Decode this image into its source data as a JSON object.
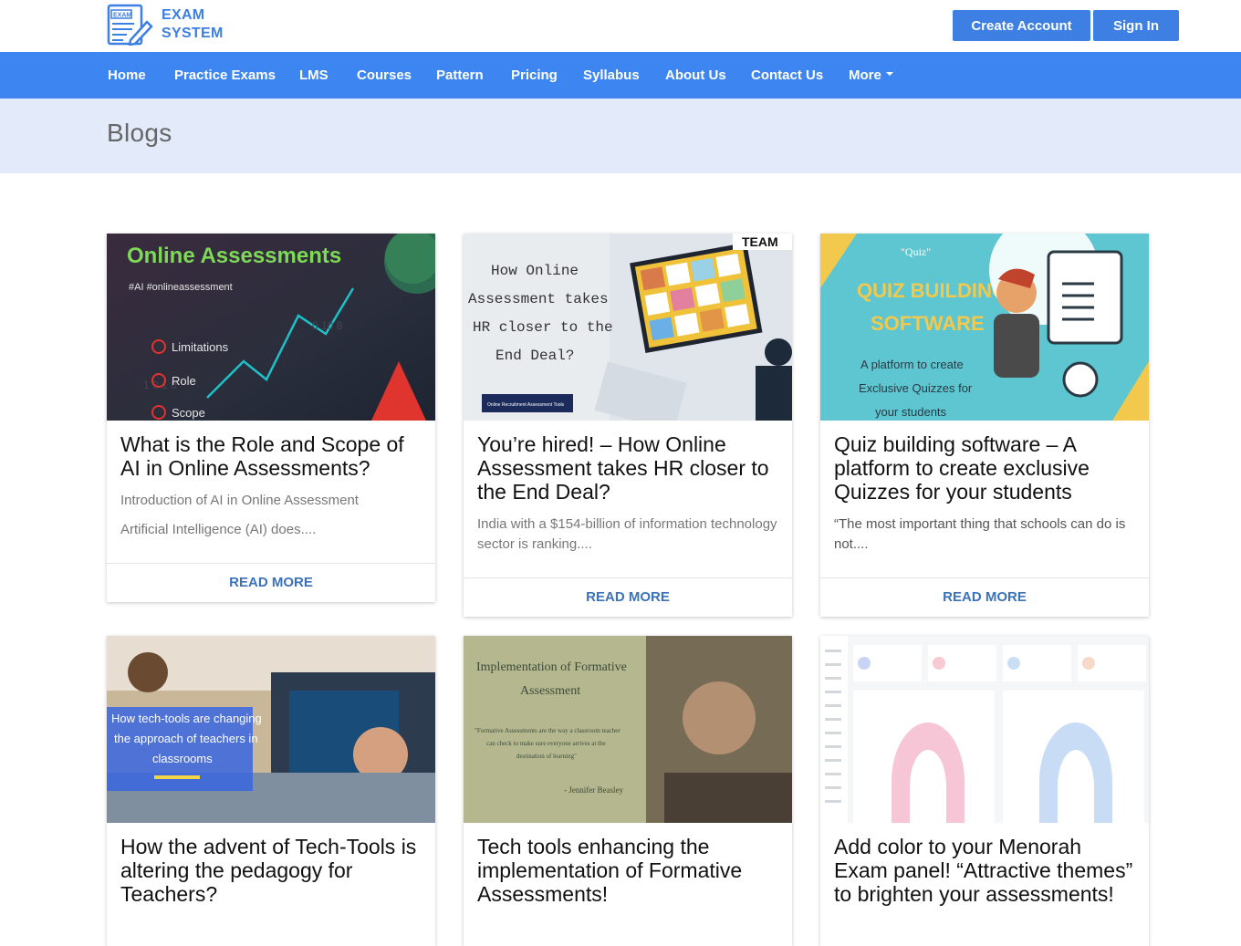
{
  "brand": {
    "line1": "EXAM",
    "line2": "SYSTEM",
    "icon": "exam-logo-icon",
    "color": "#3d7fe3"
  },
  "header": {
    "create_account": "Create Account",
    "sign_in": "Sign In"
  },
  "nav": {
    "items": [
      "Home",
      "Practice Exams",
      "LMS",
      "Courses",
      "Pattern",
      "Pricing",
      "Syllabus",
      "About Us",
      "Contact Us",
      "More"
    ],
    "more_icon": "caret-down-icon",
    "color": "#3d86f2"
  },
  "banner": {
    "title": "Blogs",
    "bg": "#e3ebfa"
  },
  "cards": [
    {
      "title": "What is the Role and Scope of AI in Online Assessments?",
      "excerpt1": "Introduction of AI in Online Assessment",
      "excerpt2": "Artificial Intelligence (AI) does....",
      "read_more": "READ MORE",
      "image": {
        "heading": "Online Assessments",
        "tag": "#AI #onlineassessment",
        "items": [
          "Limitations",
          "Role",
          "Scope"
        ]
      }
    },
    {
      "title": "You’re hired! – How Online Assessment takes HR closer to the End Deal?",
      "excerpt1": "India with a $154-billion of information technology sector is ranking....",
      "read_more": "READ MORE",
      "image": {
        "lines": [
          "How Online",
          "Assessment takes",
          "HR closer to the",
          "End Deal?"
        ],
        "corner": "TEAM"
      }
    },
    {
      "title": "Quiz building software – A platform to create exclusive Quizzes for your students",
      "excerpt1": "“The most important thing that schools can do is not....",
      "read_more": "READ MORE",
      "image": {
        "quiz_tag": "\"Quiz\"",
        "heading1": "QUIZ BUILDING",
        "heading2": "SOFTWARE",
        "sub1": "A platform to create",
        "sub2": "Exclusive Quizzes for",
        "sub3": "your students"
      }
    },
    {
      "title": "How the advent of Tech-Tools is altering the pedagogy for Teachers?",
      "image": {
        "lines": [
          "How tech-tools are changing",
          "the approach of teachers in",
          "classrooms"
        ]
      }
    },
    {
      "title": "Tech tools enhancing the implementation of Formative Assessments!",
      "image": {
        "heading1": "Implementation of Formative",
        "heading2": "Assessment",
        "quote1": "\"Formative Assessments are the way a classroom teacher",
        "quote2": "can check to make sure everyone arrives at the",
        "quote3": "destination of learning\"",
        "author": "- Jennifer Beasley"
      }
    },
    {
      "title": "Add color to your Menorah Exam panel! “Attractive themes” to brighten your assessments!"
    }
  ]
}
